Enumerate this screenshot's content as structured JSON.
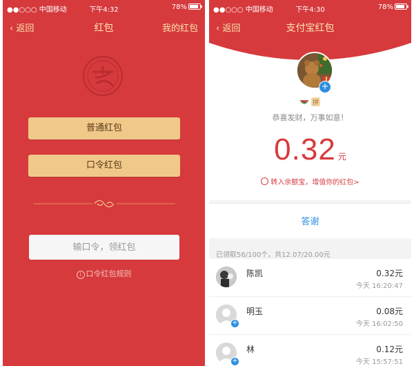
{
  "left": {
    "status": {
      "carrier": "●●○○○ 中国移动",
      "time": "下午4:32",
      "battery": "78%"
    },
    "nav": {
      "back": "返回",
      "title": "红包",
      "right": "我的红包"
    },
    "buttons": {
      "normal": "普通红包",
      "password": "口令红包"
    },
    "input_placeholder": "输口令，领红包",
    "rules_link": "口令红包规则",
    "logo_icon": "alipay-logo",
    "colors": {
      "background": "#d63a3d",
      "button": "#f0c98a",
      "nav_text": "#fbe3ad"
    }
  },
  "right": {
    "status": {
      "carrier": "●●○○○ 中国移动",
      "time": "下午4:30",
      "battery": "78%"
    },
    "nav": {
      "back": "返回",
      "title": "支付宝红包"
    },
    "tag": "拼",
    "greeting": "恭喜发财，万事如意！",
    "amount": "0.32",
    "unit": "元",
    "transfer_link": "转入余额宝，增值你的红包>",
    "thanks": "答谢",
    "summary": "已领取56/100个，共12.07/20.00元",
    "receivers": [
      {
        "name": "陈凯",
        "amount": "0.32元",
        "time": "今天 16:20:47"
      },
      {
        "name": "明玉",
        "amount": "0.08元",
        "time": "今天 16:02:50"
      },
      {
        "name": "林",
        "amount": "0.12元",
        "time": "今天 15:57:51"
      }
    ],
    "colors": {
      "accent": "#d63a3d",
      "link": "#2e8ee2"
    }
  }
}
